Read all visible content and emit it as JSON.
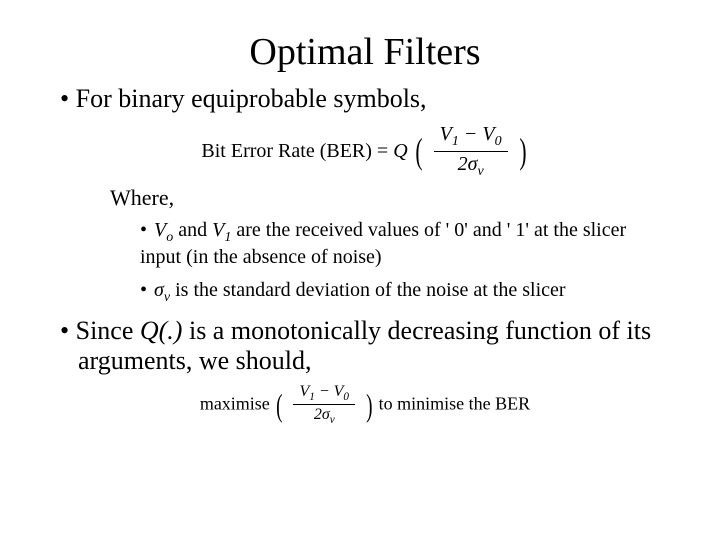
{
  "title": "Optimal Filters",
  "bullet1": "• For binary equiprobable symbols,",
  "formula1": {
    "lhs": "Bit Error Rate (BER) = ",
    "func": "Q",
    "num": "V",
    "num_sub1": "1",
    "minus": " − ",
    "num2": "V",
    "num_sub2": "0",
    "den_pre": "2σ",
    "den_sub": "ν"
  },
  "where": "Where,",
  "sub1": {
    "pre": "• ",
    "v0": "V",
    "v0s": "o",
    "and": " and ",
    "v1": "V",
    "v1s": "1",
    "rest": " are the received values of ' 0' and ' 1' at the slicer input (in the absence of noise)"
  },
  "sub2": {
    "pre": "• ",
    "sig": "σ",
    "sigs": "ν",
    "rest": " is the standard deviation of the noise at the slicer"
  },
  "bullet2_a": "• Since ",
  "bullet2_q": "Q(.)",
  "bullet2_b": " is a monotonically decreasing function of its arguments, we should,",
  "formula2": {
    "max": "maximise",
    "num": "V",
    "num_sub1": "1",
    "minus": " − ",
    "num2": "V",
    "num_sub2": "0",
    "den_pre": "2σ",
    "den_sub": "ν",
    "tail": " to minimise the BER"
  }
}
